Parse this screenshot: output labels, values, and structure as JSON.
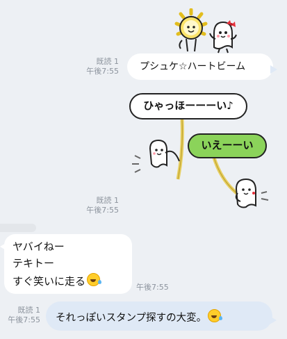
{
  "messages": {
    "m1": {
      "read": "既読 1",
      "time": "午後7:55",
      "text": "プシュケ☆ハートビーム",
      "sticker": "sun-and-ghost-character-sticker"
    },
    "m2": {
      "read": "既読 1",
      "time": "午後7:55",
      "sticker": "swinging-characters-sticker",
      "bubble_left": "ひゃっほーーーい♪",
      "bubble_right": "いえーーい"
    },
    "m3": {
      "lines": [
        "ヤバイねー",
        "テキトー",
        "すぐ笑いに走る"
      ],
      "time": "午後7:55",
      "emoji": "rolling-laughing-emoji"
    },
    "m4": {
      "read": "既読 1",
      "time": "午後7:55",
      "text": "それっぽいスタンプ探すの大変。",
      "emoji": "rolling-laughing-emoji"
    }
  },
  "colors": {
    "background": "#edf0f4",
    "sent_bubble": "#dfe9f6",
    "received_bubble": "#ffffff",
    "sticker_green": "#8bd35a"
  }
}
